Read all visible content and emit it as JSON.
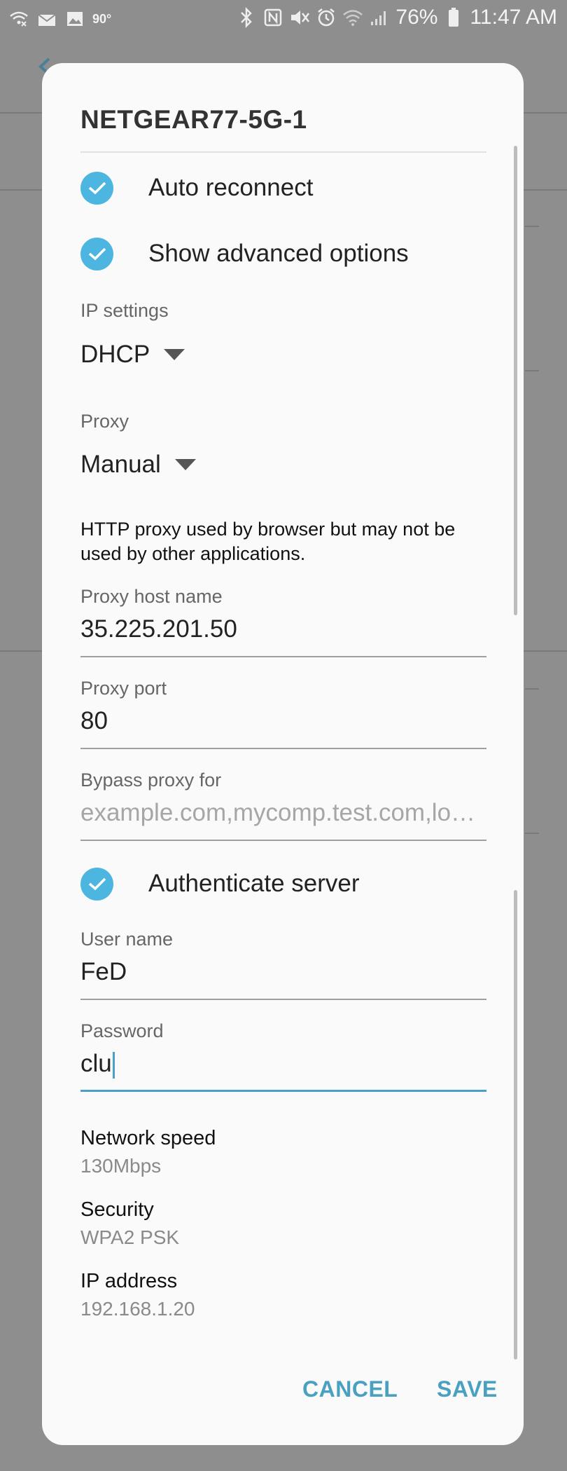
{
  "status_bar": {
    "temp": "90°",
    "battery": "76%",
    "time": "11:47 AM"
  },
  "dialog": {
    "title": "NETGEAR77-5G-1",
    "auto_reconnect": "Auto reconnect",
    "show_advanced": "Show advanced options",
    "ip_settings_label": "IP settings",
    "ip_settings_value": "DHCP",
    "proxy_label": "Proxy",
    "proxy_value": "Manual",
    "proxy_note": "HTTP proxy used by browser but may not be used by other applications.",
    "proxy_host_label": "Proxy host name",
    "proxy_host_value": "35.225.201.50",
    "proxy_port_label": "Proxy port",
    "proxy_port_value": "80",
    "bypass_label": "Bypass proxy for",
    "bypass_placeholder": "example.com,mycomp.test.com,lo…",
    "authenticate": "Authenticate server",
    "username_label": "User name",
    "username_value": "FeD",
    "password_label": "Password",
    "password_value": "clu",
    "network_speed_label": "Network speed",
    "network_speed_value": "130Mbps",
    "security_label": "Security",
    "security_value": "WPA2 PSK",
    "ip_address_label": "IP address",
    "ip_address_value": "192.168.1.20",
    "cancel": "CANCEL",
    "save": "SAVE"
  },
  "colors": {
    "accent": "#4db6e0",
    "button": "#4aa0c0"
  }
}
